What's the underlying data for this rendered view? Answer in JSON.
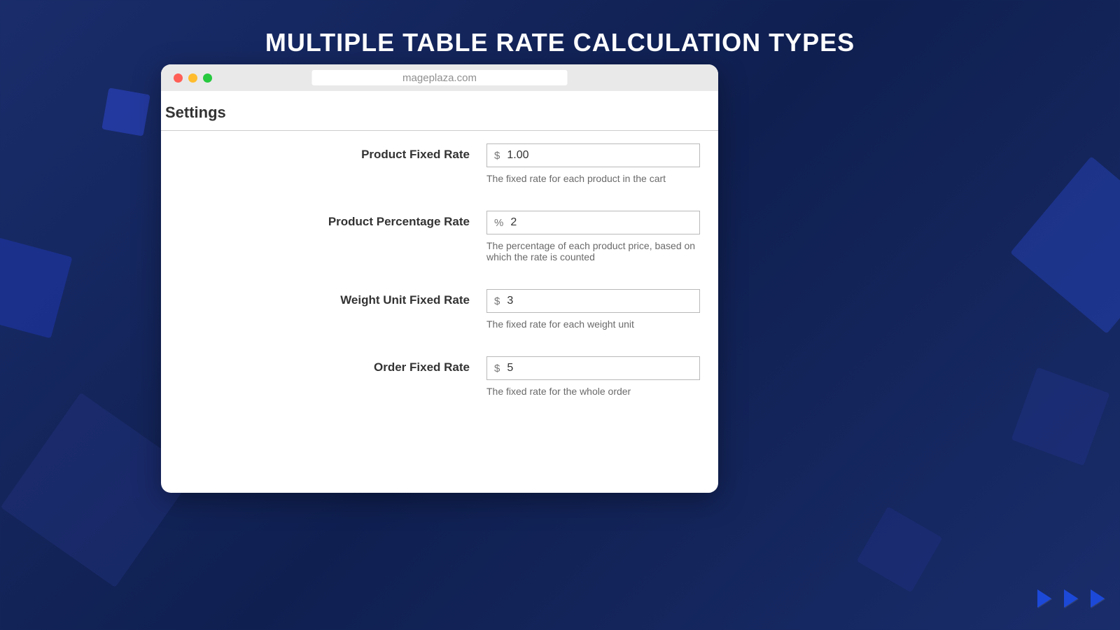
{
  "page_title": "MULTIPLE TABLE RATE CALCULATION TYPES",
  "browser": {
    "url": "mageplaza.com"
  },
  "settings": {
    "heading": "Settings",
    "fields": [
      {
        "label": "Product Fixed Rate",
        "prefix": "$",
        "value": "1.00",
        "helper": "The fixed rate for each product in the cart"
      },
      {
        "label": "Product Percentage Rate",
        "prefix": "%",
        "value": "2",
        "helper": "The percentage of each product price, based on which the rate is counted"
      },
      {
        "label": "Weight Unit Fixed Rate",
        "prefix": "$",
        "value": "3",
        "helper": "The fixed rate for each weight unit"
      },
      {
        "label": "Order Fixed Rate",
        "prefix": "$",
        "value": "5",
        "helper": "The fixed rate for the whole order"
      }
    ]
  }
}
